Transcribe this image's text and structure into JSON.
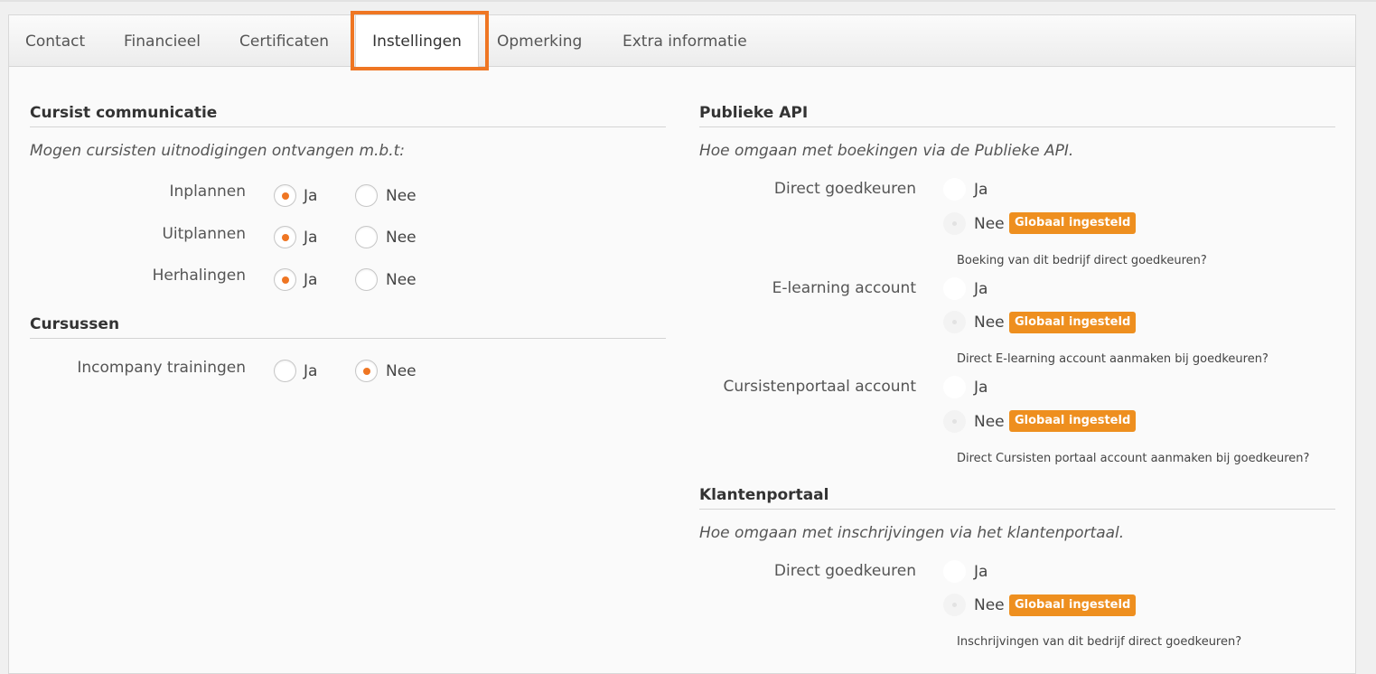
{
  "tabs": [
    {
      "label": "Contact"
    },
    {
      "label": "Financieel"
    },
    {
      "label": "Certificaten"
    },
    {
      "label": "Instellingen",
      "active": true
    },
    {
      "label": "Opmerking"
    },
    {
      "label": "Extra informatie"
    }
  ],
  "left": {
    "communicatie": {
      "title": "Cursist communicatie",
      "intro": "Mogen cursisten uitnodigingen ontvangen m.b.t:",
      "rows": [
        {
          "label": "Inplannen",
          "yes": "Ja",
          "no": "Nee",
          "selected": "Ja"
        },
        {
          "label": "Uitplannen",
          "yes": "Ja",
          "no": "Nee",
          "selected": "Ja"
        },
        {
          "label": "Herhalingen",
          "yes": "Ja",
          "no": "Nee",
          "selected": "Ja"
        }
      ]
    },
    "cursussen": {
      "title": "Cursussen",
      "rows": [
        {
          "label": "Incompany trainingen",
          "yes": "Ja",
          "no": "Nee",
          "selected": "Nee"
        }
      ]
    }
  },
  "right": {
    "api": {
      "title": "Publieke API",
      "intro": "Hoe omgaan met boekingen via de Publieke API.",
      "rows": [
        {
          "label": "Direct goedkeuren",
          "yes": "Ja",
          "no": "Nee",
          "badge": "Globaal ingesteld",
          "help": "Boeking van dit bedrijf direct goedkeuren?"
        },
        {
          "label": "E-learning account",
          "yes": "Ja",
          "no": "Nee",
          "badge": "Globaal ingesteld",
          "help": "Direct E-learning account aanmaken bij goedkeuren?"
        },
        {
          "label": "Cursistenportaal account",
          "yes": "Ja",
          "no": "Nee",
          "badge": "Globaal ingesteld",
          "help": "Direct Cursisten portaal account aanmaken bij goedkeuren?"
        }
      ]
    },
    "klantenportaal": {
      "title": "Klantenportaal",
      "intro": "Hoe omgaan met inschrijvingen via het klantenportaal.",
      "rows": [
        {
          "label": "Direct goedkeuren",
          "yes": "Ja",
          "no": "Nee",
          "badge": "Globaal ingesteld",
          "help": "Inschrijvingen van dit bedrijf direct goedkeuren?"
        }
      ]
    }
  },
  "colors": {
    "accent": "#ef7623",
    "badge": "#ee8f1f"
  }
}
